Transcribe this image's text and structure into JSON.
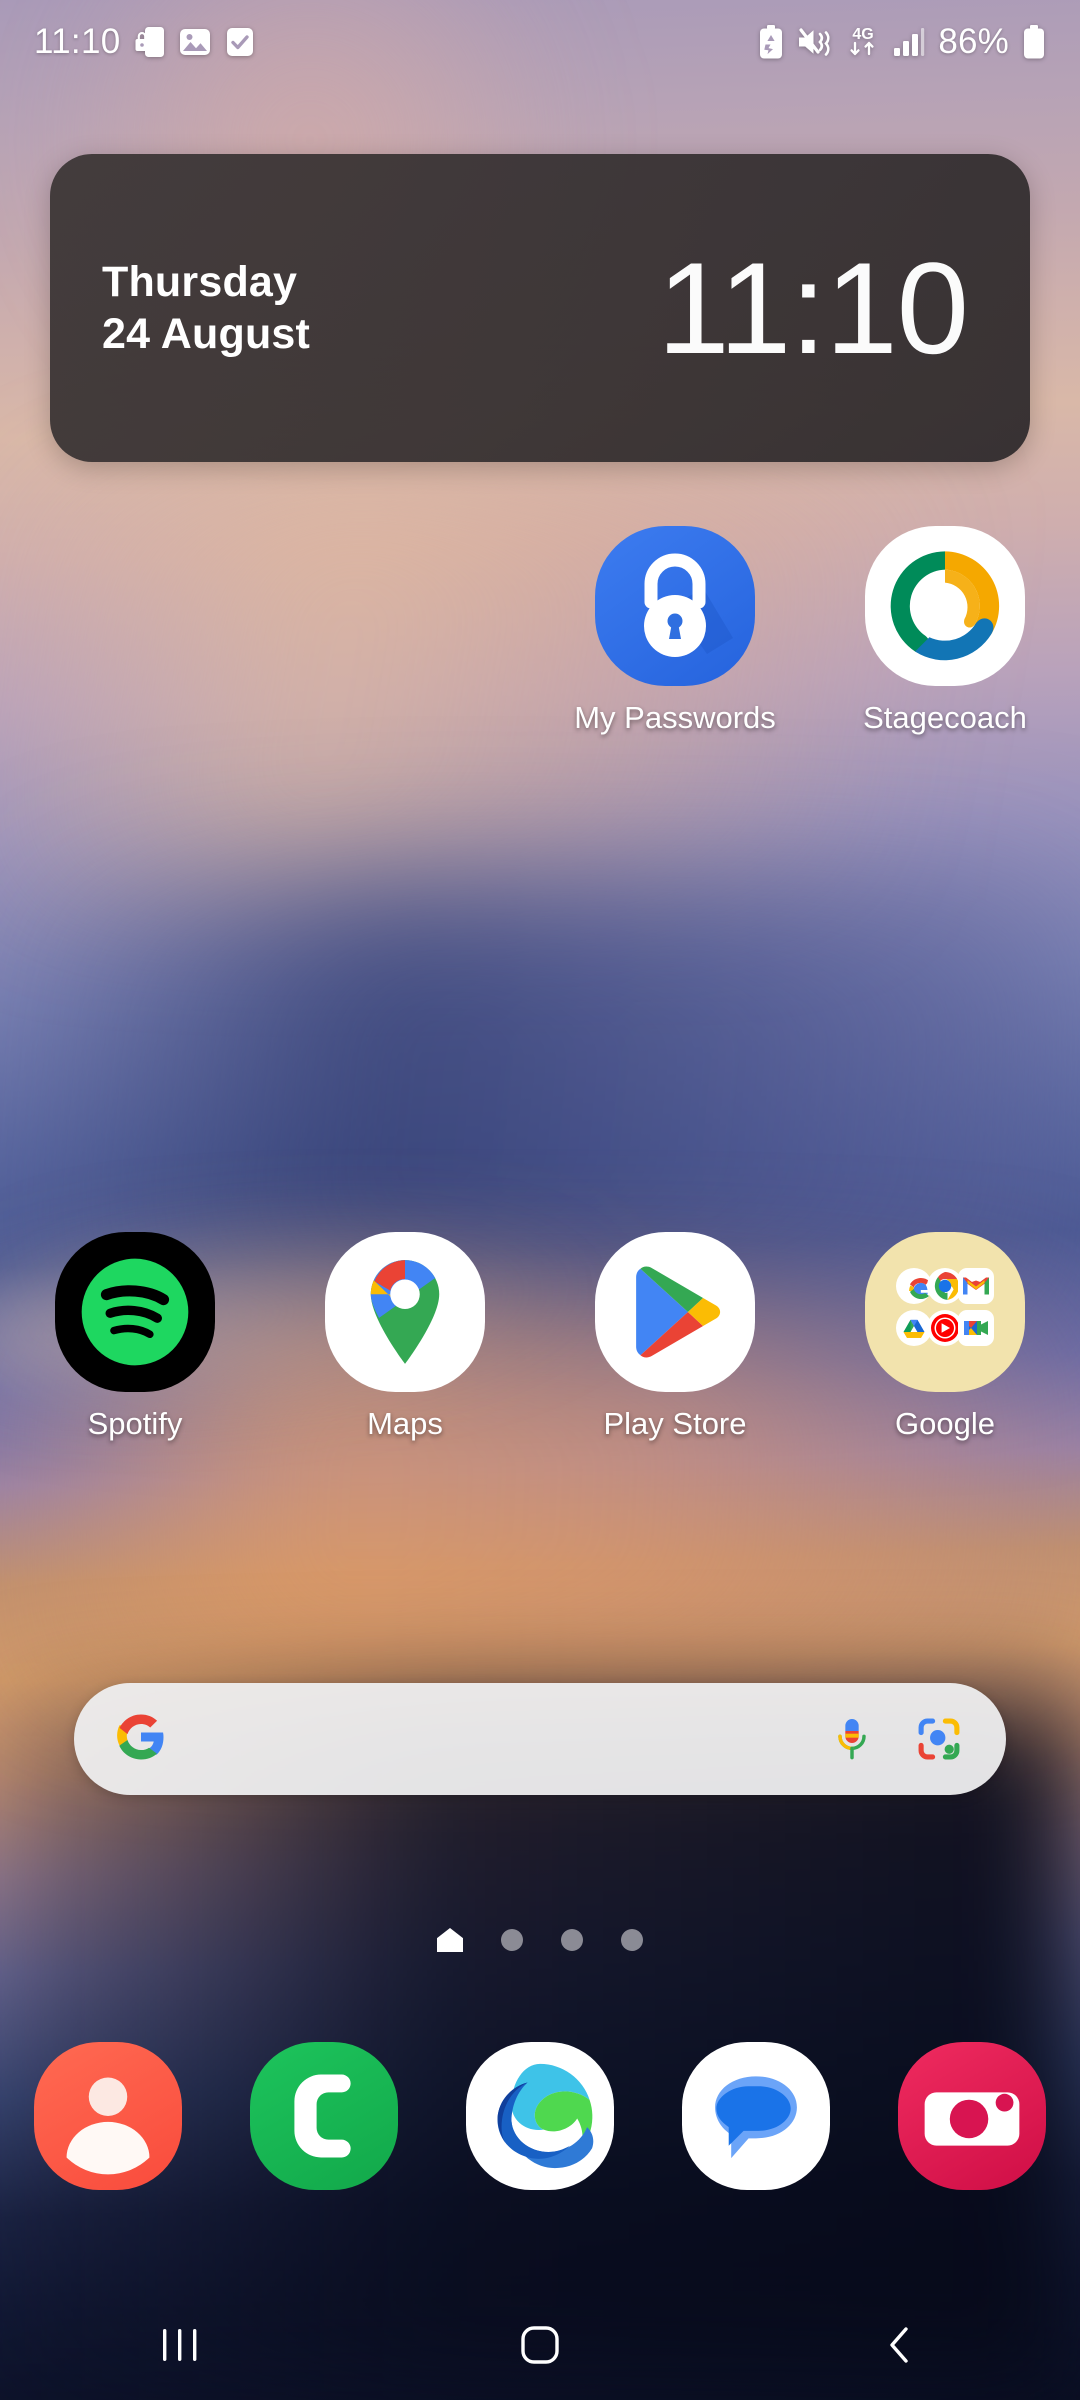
{
  "status_bar": {
    "clock": "11:10",
    "left_icons": [
      {
        "name": "secure-folder-icon",
        "glyph": "phone-lock"
      },
      {
        "name": "gallery-icon",
        "glyph": "image"
      },
      {
        "name": "tasks-icon",
        "glyph": "check"
      }
    ],
    "right_icons": [
      {
        "name": "battery-saver-icon",
        "glyph": "recycle-battery"
      },
      {
        "name": "sound-mute-vibrate-icon",
        "glyph": "mute"
      },
      {
        "name": "network-type-icon",
        "label": "4G"
      },
      {
        "name": "signal-strength-icon",
        "bars": 3
      }
    ],
    "battery_percent": "86%"
  },
  "clock_widget": {
    "weekday": "Thursday",
    "date": "24 August",
    "time": "11:10"
  },
  "home_screen": {
    "row1": [
      {
        "name": "app-my-passwords",
        "label": "My Passwords",
        "icon": "padlock-icon",
        "color": "#2f6fe0"
      },
      {
        "name": "app-stagecoach",
        "label": "Stagecoach",
        "icon": "stagecoach-swirl-icon",
        "color": "#ffffff"
      }
    ],
    "row2": [
      {
        "name": "app-spotify",
        "label": "Spotify",
        "icon": "spotify-icon",
        "color": "#000000"
      },
      {
        "name": "app-maps",
        "label": "Maps",
        "icon": "maps-pin-icon",
        "color": "#ffffff"
      },
      {
        "name": "app-play-store",
        "label": "Play Store",
        "icon": "play-store-icon",
        "color": "#ffffff"
      },
      {
        "name": "folder-google",
        "label": "Google",
        "icon": "folder-icon",
        "color": "#f2e3ad",
        "contents": [
          "Google",
          "Chrome",
          "Gmail",
          "Drive",
          "YouTube Music",
          "Meet"
        ]
      }
    ]
  },
  "search": {
    "placeholder": "",
    "value": "",
    "logo": "google-g-icon",
    "mic": "microphone-icon",
    "lens": "google-lens-icon"
  },
  "page_indicator": {
    "pages": 4,
    "active_index": 0,
    "active_glyph": "home-icon"
  },
  "dock": [
    {
      "name": "dock-contacts",
      "label": "Contacts",
      "icon": "contact-person-icon",
      "color": "#fc5b4a"
    },
    {
      "name": "dock-phone",
      "label": "Phone",
      "icon": "phone-handset-icon",
      "color": "#18b552"
    },
    {
      "name": "dock-edge",
      "label": "Microsoft Edge",
      "icon": "edge-icon",
      "color": "#ffffff"
    },
    {
      "name": "dock-messages",
      "label": "Messages",
      "icon": "chat-bubble-icon",
      "color": "#ffffff"
    },
    {
      "name": "dock-camera",
      "label": "Camera",
      "icon": "camera-icon",
      "color": "#e01f50"
    }
  ],
  "nav_bar": [
    {
      "name": "nav-recents-button",
      "glyph": "recents-icon"
    },
    {
      "name": "nav-home-button",
      "glyph": "home-square-icon"
    },
    {
      "name": "nav-back-button",
      "glyph": "back-chevron-icon"
    }
  ]
}
